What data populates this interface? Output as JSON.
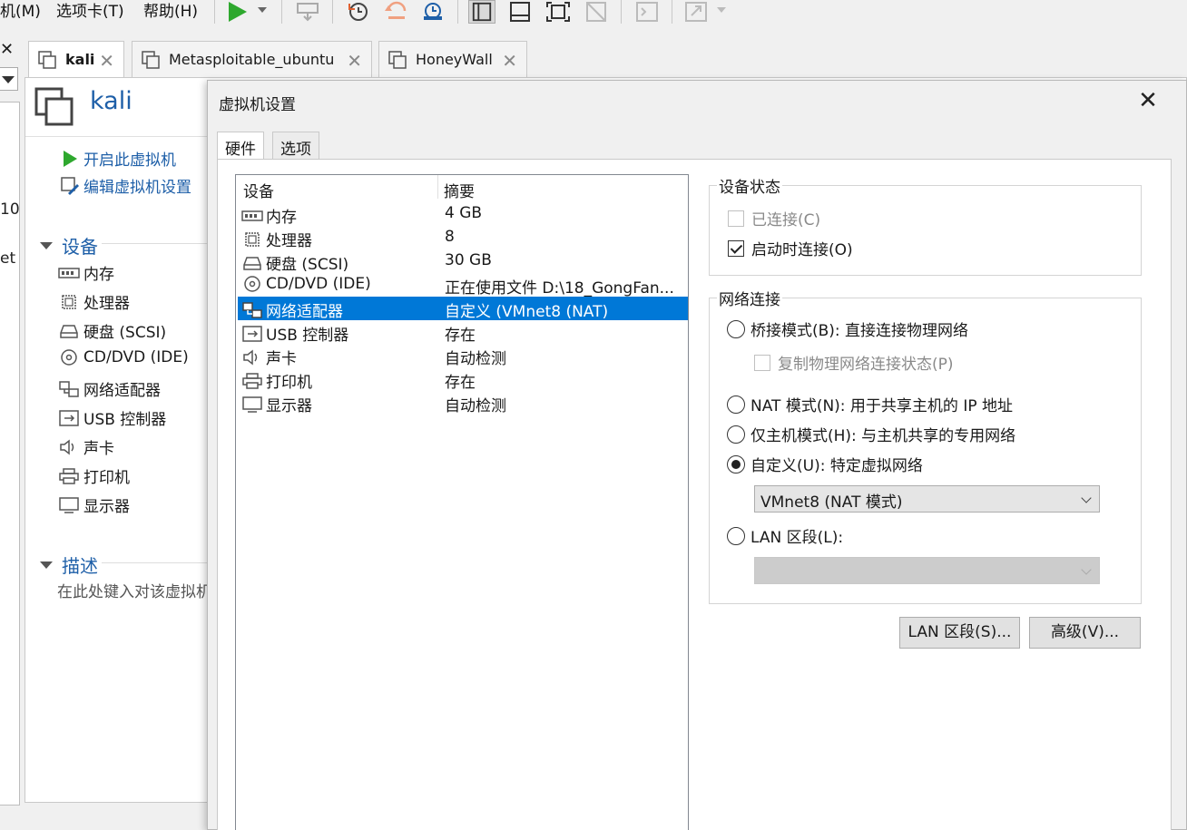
{
  "menubar": {
    "items": [
      "机(M)",
      "选项卡(T)",
      "帮助(H)"
    ]
  },
  "left_fragments": [
    "10",
    "et"
  ],
  "tabs": [
    {
      "label": "kali",
      "active": true
    },
    {
      "label": "Metasploitable_ubuntu",
      "active": false
    },
    {
      "label": "HoneyWall",
      "active": false
    }
  ],
  "vm": {
    "title": "kali",
    "actions": [
      "开启此虚拟机",
      "编辑虚拟机设置"
    ],
    "devices_heading": "设备",
    "devices": [
      "内存",
      "处理器",
      "硬盘 (SCSI)",
      "CD/DVD (IDE)",
      "网络适配器",
      "USB 控制器",
      "声卡",
      "打印机",
      "显示器"
    ],
    "desc_heading": "描述",
    "desc_placeholder": "在此处键入对该虚拟机"
  },
  "dialog": {
    "title": "虚拟机设置",
    "tabs": [
      "硬件",
      "选项"
    ],
    "list_headers": {
      "device": "设备",
      "summary": "摘要"
    },
    "rows": [
      {
        "name": "内存",
        "summary": "4 GB",
        "icon": "memory-icon"
      },
      {
        "name": "处理器",
        "summary": "8",
        "icon": "cpu-icon"
      },
      {
        "name": "硬盘 (SCSI)",
        "summary": "30 GB",
        "icon": "harddisk-icon"
      },
      {
        "name": "CD/DVD (IDE)",
        "summary": "正在使用文件 D:\\18_GongFan...",
        "icon": "cdrom-icon"
      },
      {
        "name": "网络适配器",
        "summary": "自定义 (VMnet8 (NAT)",
        "icon": "network-icon",
        "selected": true
      },
      {
        "name": "USB 控制器",
        "summary": "存在",
        "icon": "usb-icon"
      },
      {
        "name": "声卡",
        "summary": "自动检测",
        "icon": "sound-icon"
      },
      {
        "name": "打印机",
        "summary": "存在",
        "icon": "printer-icon"
      },
      {
        "name": "显示器",
        "summary": "自动检测",
        "icon": "display-icon"
      }
    ],
    "device_status": {
      "title": "设备状态",
      "connected": "已连接(C)",
      "connect_at_power_on": "启动时连接(O)"
    },
    "network": {
      "title": "网络连接",
      "bridged": "桥接模式(B): 直接连接物理网络",
      "replicate": "复制物理网络连接状态(P)",
      "nat": "NAT 模式(N): 用于共享主机的 IP 地址",
      "hostonly": "仅主机模式(H): 与主机共享的专用网络",
      "custom": "自定义(U): 特定虚拟网络",
      "custom_value": "VMnet8 (NAT 模式)",
      "lan": "LAN 区段(L):"
    },
    "buttons": {
      "lan_segments": "LAN 区段(S)...",
      "advanced": "高级(V)..."
    }
  },
  "colors": {
    "accent": "#1e5fa8",
    "selection": "#0078d7",
    "play": "#2ea82e"
  }
}
